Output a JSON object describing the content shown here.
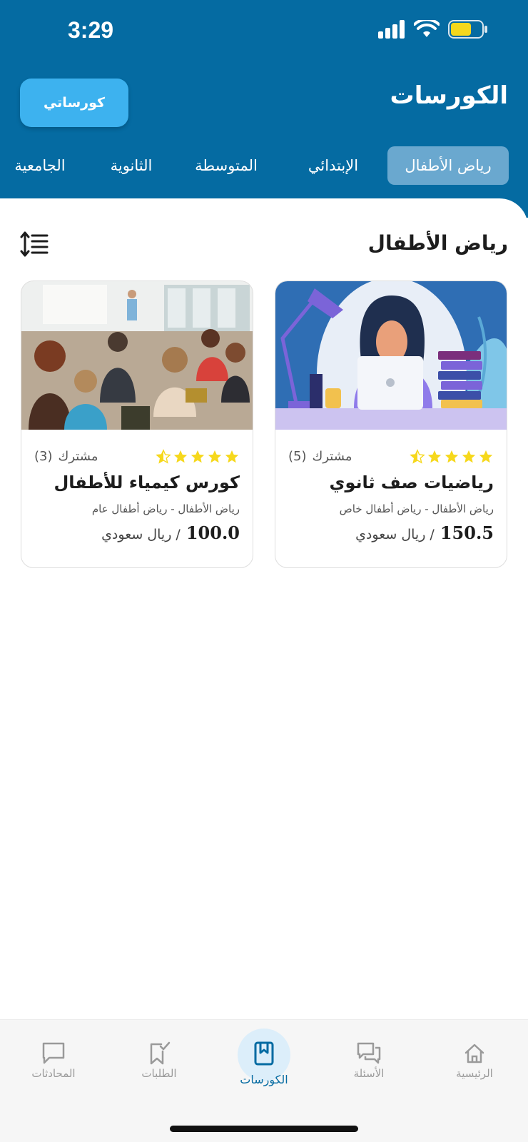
{
  "status_bar": {
    "time": "3:29"
  },
  "header": {
    "title": "الكورسات",
    "my_courses_button": "كورساتي"
  },
  "tabs": [
    {
      "label": "رياض الأطفال",
      "active": true
    },
    {
      "label": "الإبتدائي",
      "active": false
    },
    {
      "label": "المتوسطة",
      "active": false
    },
    {
      "label": "الثانوية",
      "active": false
    },
    {
      "label": "الجامعية",
      "active": false
    }
  ],
  "section": {
    "title": "رياض الأطفال"
  },
  "courses": [
    {
      "title": "رياضيات صف ثانوي",
      "category": "رياض الأطفال - رياض أطفال خاص",
      "rating": 4.5,
      "subscribers_count": "(5)",
      "subscribers_label": "مشترك",
      "price": "150.5",
      "currency": "/ ريال سعودي",
      "image": "woman-laptop-illustration"
    },
    {
      "title": "كورس كيمياء للأطفال",
      "category": "رياض الأطفال - رياض أطفال عام",
      "rating": 4.5,
      "subscribers_count": "(3)",
      "subscribers_label": "مشترك",
      "price": "100.0",
      "currency": "/ ريال سعودي",
      "image": "classroom-photo"
    }
  ],
  "bottom_nav": [
    {
      "label": "الرئيسية",
      "icon": "home-icon",
      "active": false
    },
    {
      "label": "الأسئلة",
      "icon": "questions-icon",
      "active": false
    },
    {
      "label": "الكورسات",
      "icon": "book-icon",
      "active": true
    },
    {
      "label": "الطلبات",
      "icon": "requests-icon",
      "active": false
    },
    {
      "label": "المحادثات",
      "icon": "chat-icon",
      "active": false
    }
  ],
  "colors": {
    "primary": "#056ba2",
    "button": "#3db2ef",
    "active_tab": "#6aa8cf",
    "star": "#f6d81c",
    "nav_inactive": "#9a9a9a"
  }
}
